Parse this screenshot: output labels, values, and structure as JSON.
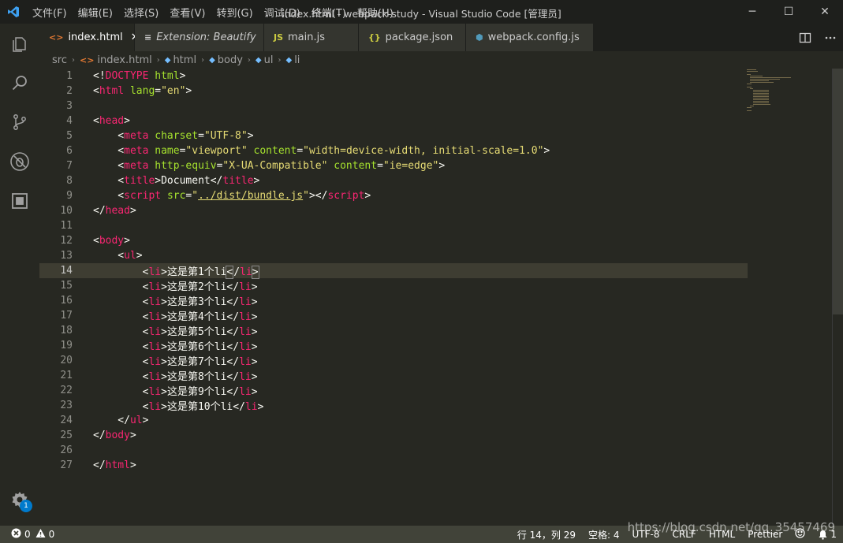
{
  "window": {
    "title": "index.html - webpack-study - Visual Studio Code [管理员]",
    "menu": [
      "文件(F)",
      "编辑(E)",
      "选择(S)",
      "查看(V)",
      "转到(G)",
      "调试(D)",
      "终端(T)",
      "帮助(H)"
    ],
    "controls": {
      "minimize": "─",
      "maximize": "☐",
      "close": "✕"
    }
  },
  "tabs": [
    {
      "label": "index.html",
      "icon_text": "<>",
      "icon_color": "#e37933",
      "active": true,
      "close": "✕"
    },
    {
      "label": "Extension: Beautify",
      "icon_text": "≡",
      "icon_color": "#cccccc",
      "active": false
    },
    {
      "label": "main.js",
      "icon_text": "JS",
      "icon_color": "#cbcb41",
      "active": false
    },
    {
      "label": "package.json",
      "icon_text": "{}",
      "icon_color": "#cbcb41",
      "active": false
    },
    {
      "label": "webpack.config.js",
      "icon_text": "⬢",
      "icon_color": "#519aba",
      "active": false
    }
  ],
  "breadcrumb": [
    "src",
    "index.html",
    "html",
    "body",
    "ul",
    "li"
  ],
  "editor": {
    "current_line": 14,
    "line_numbers": [
      "1",
      "2",
      "3",
      "4",
      "5",
      "6",
      "7",
      "8",
      "9",
      "10",
      "11",
      "12",
      "13",
      "14",
      "15",
      "16",
      "17",
      "18",
      "19",
      "20",
      "21",
      "22",
      "23",
      "24",
      "25",
      "26",
      "27"
    ],
    "li_items": [
      "这是第1个li",
      "这是第2个li",
      "这是第3个li",
      "这是第4个li",
      "这是第5个li",
      "这是第6个li",
      "这是第7个li",
      "这是第8个li",
      "这是第9个li",
      "这是第10个li"
    ],
    "text": {
      "doctype": "DOCTYPE",
      "html_kw": "html",
      "lang_attr": "lang",
      "lang_val": "\"en\"",
      "head": "head",
      "meta": "meta",
      "charset_attr": "charset",
      "charset_val": "\"UTF-8\"",
      "name_attr": "name",
      "name_val": "\"viewport\"",
      "content_attr": "content",
      "content_val": "\"width=device-width, initial-scale=1.0\"",
      "httpequiv_attr": "http-equiv",
      "httpequiv_val": "\"X-UA-Compatible\"",
      "ie_val": "\"ie=edge\"",
      "title_tag": "title",
      "title_text": "Document",
      "script_tag": "script",
      "src_attr": "src",
      "src_val": "../dist/bundle.js",
      "body": "body",
      "ul": "ul",
      "li": "li"
    }
  },
  "activity": {
    "items": [
      "explorer-icon",
      "search-icon",
      "source-control-icon",
      "debug-icon",
      "extensions-icon"
    ],
    "settings_badge": "1"
  },
  "statusbar": {
    "errors": "0",
    "warnings": "0",
    "position": "行 14，列 29",
    "indent": "空格: 4",
    "encoding": "UTF-8",
    "eol": "CRLF",
    "language": "HTML",
    "formatter": "Prettier",
    "watermark": "https://blog.csdn.net/qq_35457469"
  },
  "colors": {
    "tag": "#f92672",
    "attr": "#a6e22e",
    "string": "#e6db74",
    "text": "#f8f8f2",
    "background": "#272822"
  }
}
